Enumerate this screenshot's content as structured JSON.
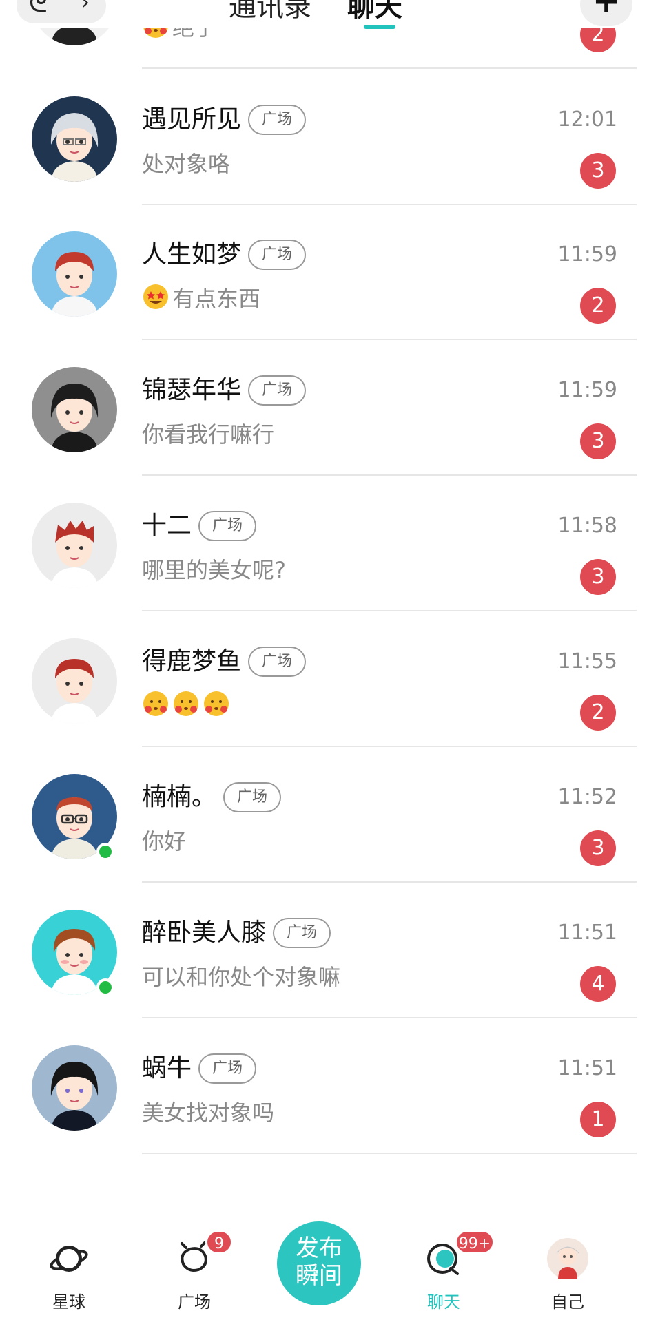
{
  "header": {
    "left_glyph": "ᘓ",
    "left_chevron": "›",
    "tabs": [
      {
        "label": "通讯录",
        "active": false
      },
      {
        "label": "聊天",
        "active": true
      }
    ],
    "plus_label": "+"
  },
  "colors": {
    "accent": "#22c3bd",
    "badge": "#e04a52",
    "online": "#22bb44"
  },
  "chats": [
    {
      "name": "",
      "tag": "",
      "msg": "绝了",
      "emoji": [
        "shy-face-icon"
      ],
      "time": "",
      "unread": "2",
      "online": false,
      "avatar": "avatar-dark-partial"
    },
    {
      "name": "遇见所见",
      "tag": "广场",
      "msg": "处对象咯",
      "emoji": [],
      "time": "12:01",
      "unread": "3",
      "online": false,
      "avatar": "avatar-silver-hair"
    },
    {
      "name": "人生如梦",
      "tag": "广场",
      "msg": "有点东西",
      "emoji": [
        "star-eyes-face-icon"
      ],
      "time": "11:59",
      "unread": "2",
      "online": false,
      "avatar": "avatar-red-hair-blue-bg"
    },
    {
      "name": "锦瑟年华",
      "tag": "广场",
      "msg": "你看我行嘛行",
      "emoji": [],
      "time": "11:59",
      "unread": "3",
      "online": false,
      "avatar": "avatar-dark-hair-grey-bg"
    },
    {
      "name": "十二",
      "tag": "广场",
      "msg": "哪里的美女呢?",
      "emoji": [],
      "time": "11:58",
      "unread": "3",
      "online": false,
      "avatar": "avatar-red-spiky-hair"
    },
    {
      "name": "得鹿梦鱼",
      "tag": "广场",
      "msg": "",
      "emoji": [
        "shy-face-icon",
        "shy-face-icon",
        "shy-face-icon"
      ],
      "time": "11:55",
      "unread": "2",
      "online": false,
      "avatar": "avatar-red-hair-light-bg"
    },
    {
      "name": "楠楠。",
      "tag": "广场",
      "msg": "你好",
      "emoji": [],
      "time": "11:52",
      "unread": "3",
      "online": true,
      "avatar": "avatar-glasses"
    },
    {
      "name": "醉卧美人膝",
      "tag": "广场",
      "msg": "可以和你处个对象嘛",
      "emoji": [],
      "time": "11:51",
      "unread": "4",
      "online": true,
      "avatar": "avatar-brown-hair-teal-bg"
    },
    {
      "name": "蜗牛",
      "tag": "广场",
      "msg": "美女找对象吗",
      "emoji": [],
      "time": "11:51",
      "unread": "1",
      "online": false,
      "avatar": "avatar-dark-hair-blue-bg"
    }
  ],
  "bottom_nav": {
    "items": [
      {
        "label": "星球",
        "icon": "planet-icon",
        "badge": ""
      },
      {
        "label": "广场",
        "icon": "square-icon",
        "badge": "9"
      },
      {
        "label": "聊天",
        "icon": "chat-icon",
        "badge": "99+"
      },
      {
        "label": "自己",
        "icon": "profile-avatar",
        "badge": ""
      }
    ],
    "publish_line1": "发布",
    "publish_line2": "瞬间"
  }
}
